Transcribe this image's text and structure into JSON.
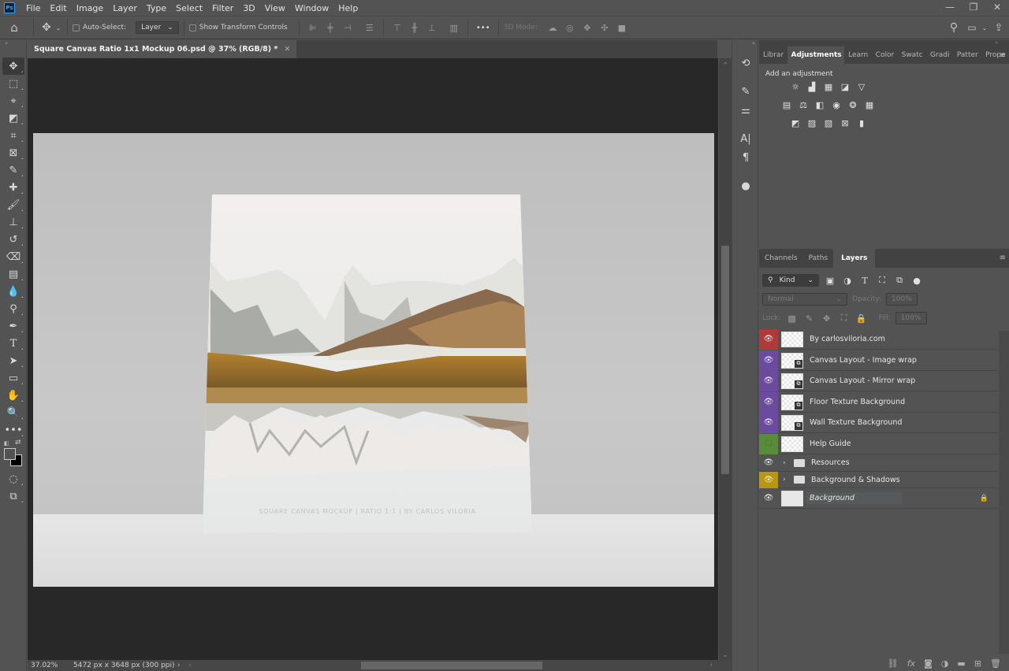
{
  "app": {
    "logo": "Ps"
  },
  "menu": [
    "File",
    "Edit",
    "Image",
    "Layer",
    "Type",
    "Select",
    "Filter",
    "3D",
    "View",
    "Window",
    "Help"
  ],
  "window_controls": {
    "minimize": "—",
    "restore": "❐",
    "close": "✕"
  },
  "options_bar": {
    "auto_select_label": "Auto-Select:",
    "auto_select_checked": false,
    "auto_select_target": "Layer",
    "show_transform_label": "Show Transform Controls",
    "show_transform_checked": false,
    "more": "•••",
    "mode_3d_label": "3D Mode:"
  },
  "document": {
    "tab_title": "Square Canvas Ratio 1x1 Mockup 06.psd @ 37% (RGB/8) *",
    "close": "✕",
    "watermark": "SQUARE CANVAS MOCKUP | RATIO 1:1 | BY CARLOS VILORIA"
  },
  "status": {
    "zoom": "37.02%",
    "doc_info": "5472 px x 3648 px (300 ppi)",
    "arrow": "›"
  },
  "top_panel": {
    "tabs": [
      "Librar",
      "Adjustments",
      "Learn",
      "Color",
      "Swatc",
      "Gradi",
      "Patter",
      "Prope"
    ],
    "active_tab": "Adjustments",
    "add_adjustment": "Add an adjustment"
  },
  "layers_panel": {
    "tabs": [
      "Channels",
      "Paths",
      "Layers"
    ],
    "active_tab": "Layers",
    "filter_kind": "Kind",
    "blend_mode": "Normal",
    "opacity_label": "Opacity:",
    "opacity": "100%",
    "lock_label": "Lock:",
    "fill_label": "Fill:",
    "fill": "100%",
    "layers": [
      {
        "name": "By carlosviloria.com",
        "color": "#b03a3a",
        "visible": true,
        "type": "pixel"
      },
      {
        "name": "Canvas Layout - Image wrap",
        "color": "#6b4ba0",
        "visible": true,
        "type": "smart"
      },
      {
        "name": "Canvas Layout - Mirror wrap",
        "color": "#6b4ba0",
        "visible": true,
        "type": "smart"
      },
      {
        "name": "Floor Texture Background",
        "color": "#6b4ba0",
        "visible": true,
        "type": "smart"
      },
      {
        "name": "Wall Texture Background",
        "color": "#6b4ba0",
        "visible": true,
        "type": "smart"
      },
      {
        "name": "Help Guide",
        "color": "#5a8a3c",
        "visible": false,
        "type": "pixel"
      },
      {
        "name": "Resources",
        "color": "",
        "visible": true,
        "type": "group"
      },
      {
        "name": "Background & Shadows",
        "color": "#b8960e",
        "visible": true,
        "type": "group"
      },
      {
        "name": "Background",
        "color": "",
        "visible": true,
        "type": "background",
        "locked": true
      }
    ]
  }
}
